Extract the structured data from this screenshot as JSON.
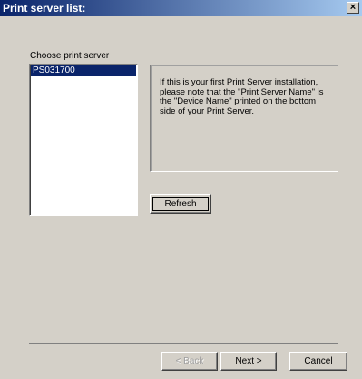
{
  "window": {
    "title": "Print server list:",
    "close_label": "×"
  },
  "main": {
    "choose_label": "Choose print server",
    "servers": [
      "PS031700"
    ],
    "info_text": "If this is your first Print Server installation, please note that the \"Print Server Name\" is the \"Device Name\" printed on the bottom side of your Print Server.",
    "refresh_label": "Refresh"
  },
  "footer": {
    "back_label": "< Back",
    "next_label": "Next >",
    "cancel_label": "Cancel"
  },
  "colors": {
    "title_bar": "#0a246a",
    "selection": "#0a246a",
    "face": "#d4d0c8"
  }
}
